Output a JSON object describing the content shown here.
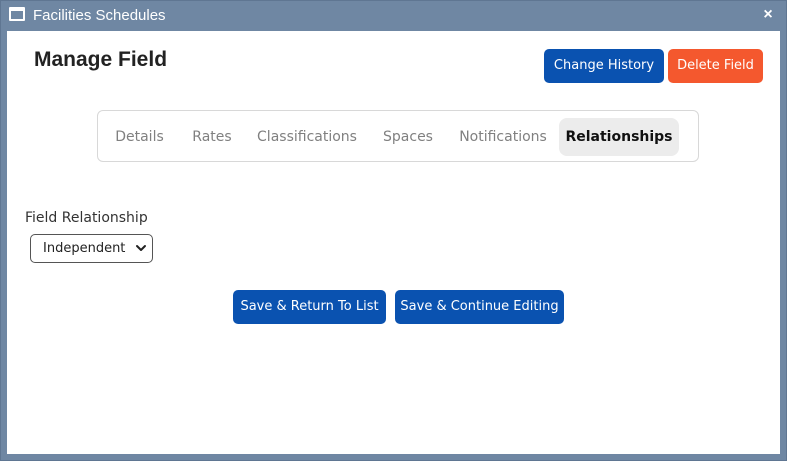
{
  "window": {
    "title": "Facilities Schedules",
    "close_symbol": "×",
    "icon": "window-icon"
  },
  "header": {
    "page_title": "Manage Field",
    "change_history_label": "Change History",
    "delete_field_label": "Delete Field"
  },
  "tabs": [
    {
      "label": "Details",
      "active": false
    },
    {
      "label": "Rates",
      "active": false
    },
    {
      "label": "Classifications",
      "active": false
    },
    {
      "label": "Spaces",
      "active": false
    },
    {
      "label": "Notifications",
      "active": false
    },
    {
      "label": "Relationships",
      "active": true
    }
  ],
  "form": {
    "relationship_label": "Field Relationship",
    "relationship_value": "Independent",
    "relationship_icon": "chevron-down-icon"
  },
  "actions": {
    "save_return_label": "Save & Return To List",
    "save_continue_label": "Save & Continue Editing"
  },
  "colors": {
    "titlebar": "#6f87a3",
    "primary": "#0a52b0",
    "danger": "#f4582e",
    "active_tab_bg": "#ececec"
  }
}
